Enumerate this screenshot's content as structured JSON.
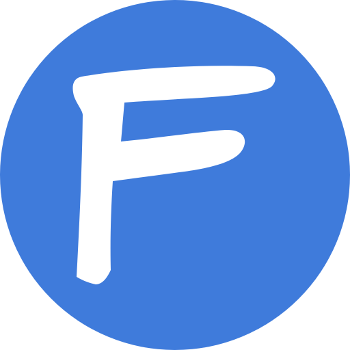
{
  "logo": {
    "name": "letter-f-logo",
    "letter": "F",
    "colors": {
      "circle": "#3f7bdb",
      "letter": "#ffffff"
    }
  }
}
